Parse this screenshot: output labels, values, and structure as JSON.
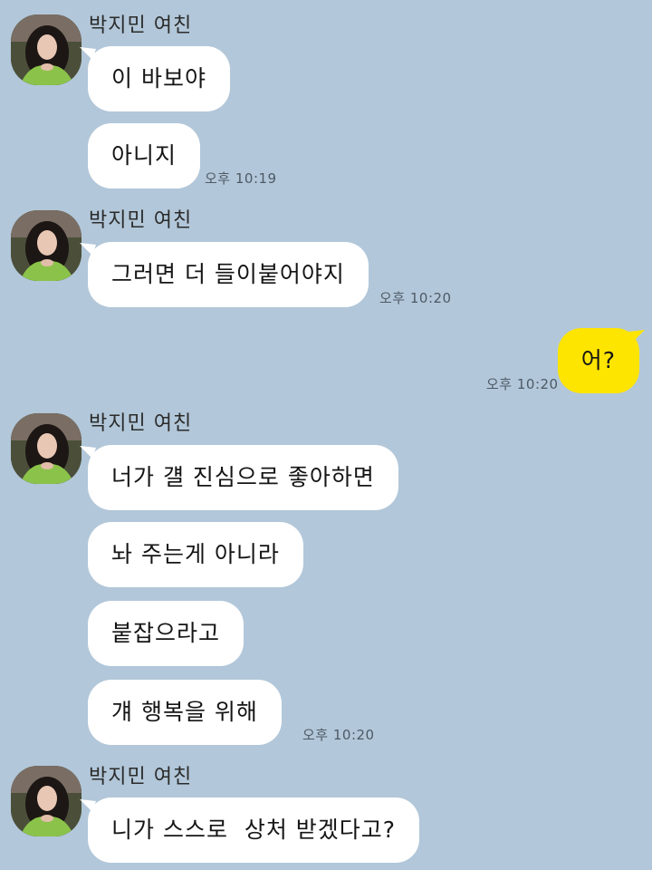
{
  "chat": {
    "sender_name": "박지민 여친",
    "groups": [
      {
        "messages": [
          "이 바보야",
          "아니지"
        ],
        "time": "오후 10:19"
      },
      {
        "messages": [
          "그러면 더 들이붙어야지"
        ],
        "time": "오후 10:20"
      },
      {
        "messages": [
          "너가 걜 진심으로 좋아하면",
          "놔 주는게 아니라",
          "붙잡으라고",
          "걔 행복을 위해"
        ],
        "time": "오후 10:20"
      },
      {
        "messages": [
          "니가 스스로  상처 받겠다고?"
        ]
      }
    ],
    "sent": {
      "message": "어?",
      "time": "오후 10:20"
    }
  },
  "colors": {
    "background": "#b2c7d9",
    "incoming_bubble": "#ffffff",
    "outgoing_bubble": "#fee500"
  }
}
